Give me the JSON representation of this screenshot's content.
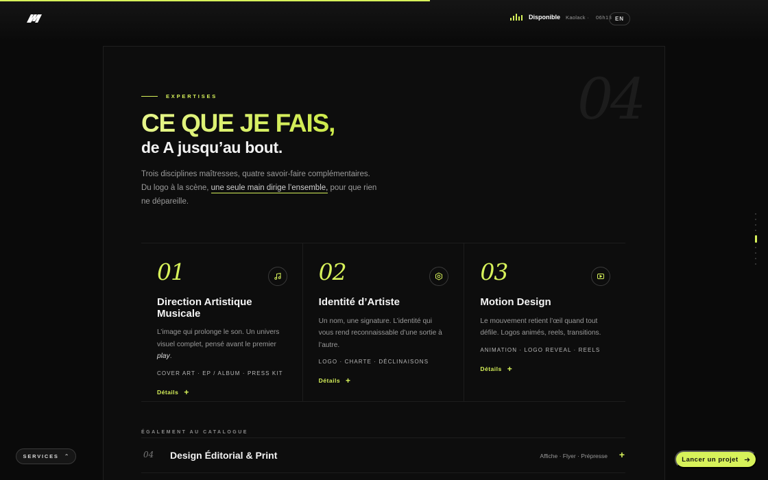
{
  "header": {
    "progress_pct": 56,
    "status_label": "Disponible",
    "status_location": "Kaolack ·",
    "status_time": "06h13",
    "lang": "EN",
    "logo_icon": "brand-logo-icon"
  },
  "section": {
    "big_number": "04",
    "eyebrow": "EXPERTISES",
    "headline": "CE QUE JE FAIS,",
    "subheadline": "de A jusqu’au bout.",
    "intro_before": "Trois disciplines maîtresses, quatre savoir-faire complémentaires. Du logo à la scène, ",
    "intro_highlight": "une seule main dirige l’ensemble,",
    "intro_after": " pour que rien ne dépareille."
  },
  "cards": [
    {
      "num": "01",
      "icon": "music-note-icon",
      "title": "Direction Artistique Musicale",
      "desc_before": "L’image qui prolonge le son. Un univers visuel complet, pensé avant le premier ",
      "desc_em": "play",
      "desc_after": ".",
      "tags": "COVER ART · EP / ALBUM · PRESS KIT",
      "link": "Détails",
      "link_icon": "plus-icon"
    },
    {
      "num": "02",
      "icon": "hexagon-icon",
      "title": "Identité d’Artiste",
      "desc": "Un nom, une signature. L’identité qui vous rend reconnaissable d’une sortie à l’autre.",
      "tags": "LOGO · CHARTE · DÉCLINAISONS",
      "link": "Détails",
      "link_icon": "plus-icon"
    },
    {
      "num": "03",
      "icon": "play-icon",
      "title": "Motion Design",
      "desc": "Le mouvement retient l’œil quand tout défile. Logos animés, reels, transitions.",
      "tags": "ANIMATION · LOGO REVEAL · REELS",
      "link": "Détails",
      "link_icon": "plus-icon"
    }
  ],
  "catalog": {
    "label": "ÉGALEMENT AU CATALOGUE",
    "items": [
      {
        "num": "04",
        "title": "Design Éditorial & Print",
        "tags": "Affiche · Flyer · Prépresse",
        "icon": "plus-icon"
      }
    ]
  },
  "footer": {
    "services_label": "SERVICES",
    "services_icon": "chevron-up-down-icon",
    "cta_label": "Lancer un projet",
    "cta_icon": "arrow-right-icon"
  },
  "colors": {
    "accent": "#d7f25a",
    "background": "#0a0a0a",
    "panel": "#0d0d0d"
  }
}
